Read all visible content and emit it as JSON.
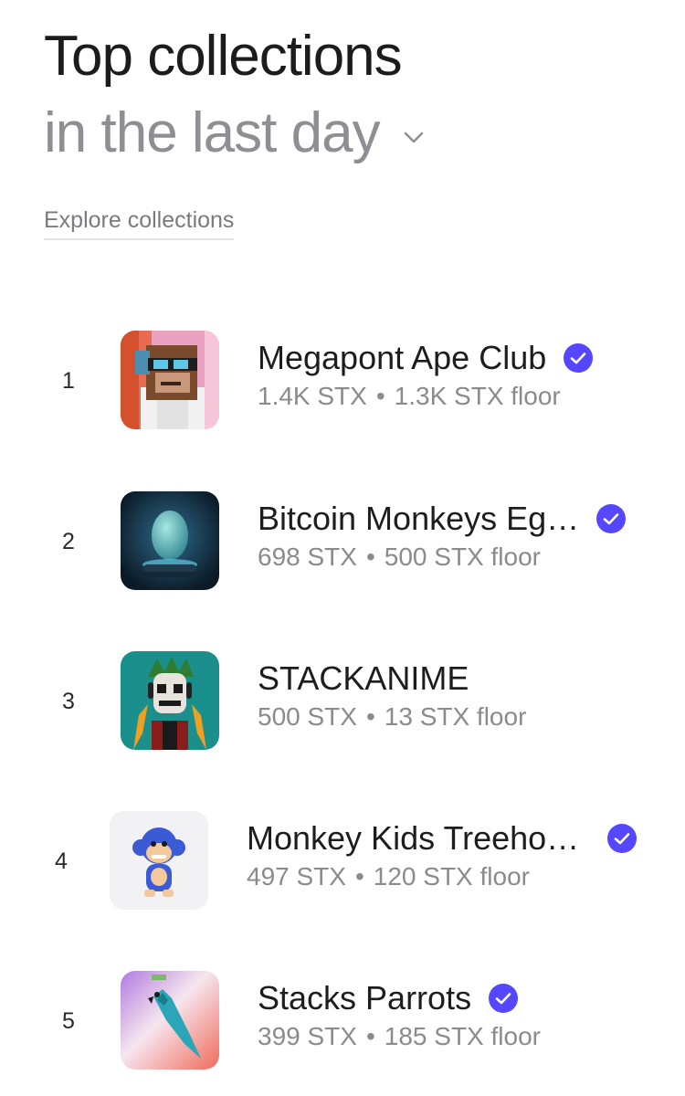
{
  "header": {
    "title": "Top collections",
    "period": "in the last day",
    "explore_link": "Explore collections"
  },
  "collections": [
    {
      "rank": "1",
      "name": "Megapont Ape Club",
      "volume": "1.4K STX",
      "floor": "1.3K STX floor",
      "verified": true
    },
    {
      "rank": "2",
      "name": "Bitcoin Monkeys Eg…",
      "volume": "698 STX",
      "floor": "500 STX floor",
      "verified": true
    },
    {
      "rank": "3",
      "name": "STACKANIME",
      "volume": "500 STX",
      "floor": "13 STX floor",
      "verified": false
    },
    {
      "rank": "4",
      "name": "Monkey Kids Treeho…",
      "volume": "497 STX",
      "floor": "120 STX floor",
      "verified": true
    },
    {
      "rank": "5",
      "name": "Stacks Parrots",
      "volume": "399 STX",
      "floor": "185 STX floor",
      "verified": true
    }
  ],
  "separator": "•",
  "colors": {
    "verified": "#5546ff",
    "muted": "#8a8a90",
    "text": "#1d1d21"
  }
}
